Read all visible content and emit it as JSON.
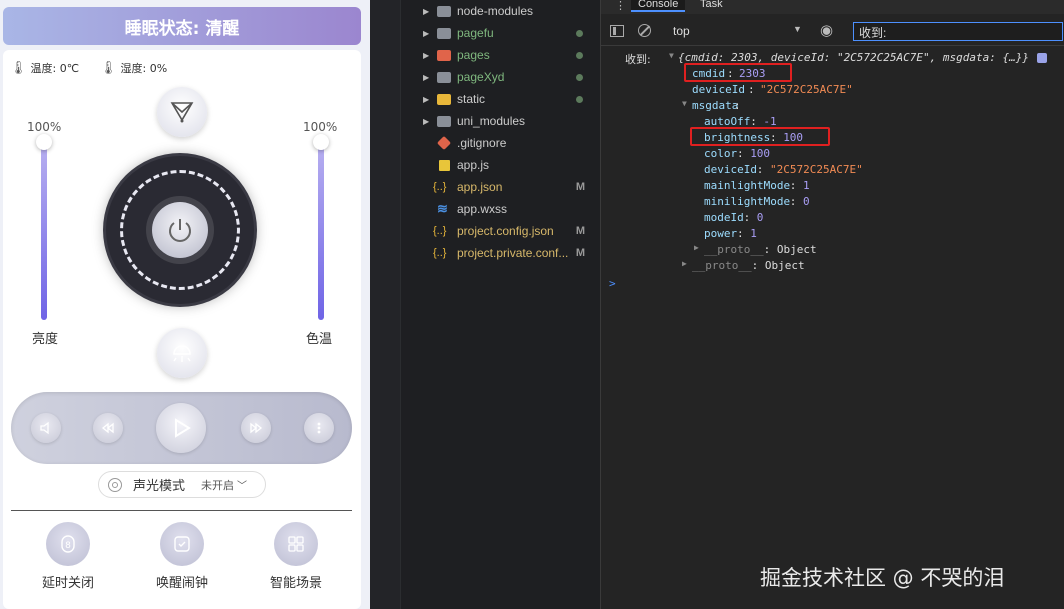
{
  "phone": {
    "title": "睡眠状态: 清醒",
    "temperature": "温度: 0℃",
    "humidity": "湿度: 0%",
    "brightness_pct": "100%",
    "colortemp_pct": "100%",
    "brightness_level": 1.0,
    "colortemp_level": 1.0,
    "brightness_label": "亮度",
    "colortemp_label": "色温",
    "mode_label": "声光模式",
    "mode_value": "未开启",
    "bottom": [
      {
        "label": "延时关闭"
      },
      {
        "label": "唤醒闹钟"
      },
      {
        "label": "智能场景"
      }
    ]
  },
  "explorer": {
    "items": [
      {
        "name": "node-modules",
        "type": "folder",
        "color": "#8a8f98",
        "text_color": "#cccccc",
        "badge": ""
      },
      {
        "name": "pagefu",
        "type": "folder",
        "color": "#8a8f98",
        "text_color": "#7fb77e",
        "badge": "dot"
      },
      {
        "name": "pages",
        "type": "folder",
        "color": "#e0644a",
        "text_color": "#7fb77e",
        "badge": "dot"
      },
      {
        "name": "pageXyd",
        "type": "folder",
        "color": "#8a8f98",
        "text_color": "#7fb77e",
        "badge": "dot"
      },
      {
        "name": "static",
        "type": "folder",
        "color": "#e8b73a",
        "text_color": "#cccccc",
        "badge": "dot"
      },
      {
        "name": "uni_modules",
        "type": "folder",
        "color": "#8a8f98",
        "text_color": "#cccccc",
        "badge": ""
      },
      {
        "name": ".gitignore",
        "type": "git",
        "color": "#e0644a",
        "text_color": "#cccccc",
        "badge": ""
      },
      {
        "name": "app.js",
        "type": "js",
        "color": "#e8c53a",
        "text_color": "#cccccc",
        "badge": ""
      },
      {
        "name": "app.json",
        "type": "json",
        "color": "#e8b73a",
        "text_color": "#d7b86a",
        "badge": "M"
      },
      {
        "name": "app.wxss",
        "type": "css",
        "color": "#4a8fe0",
        "text_color": "#cccccc",
        "badge": ""
      },
      {
        "name": "project.config.json",
        "type": "json",
        "color": "#e8b73a",
        "text_color": "#d7b86a",
        "badge": "M"
      },
      {
        "name": "project.private.conf...",
        "type": "json",
        "color": "#e8b73a",
        "text_color": "#d7b86a",
        "badge": "M"
      }
    ]
  },
  "devtools": {
    "tabs": [
      "Console",
      "Task"
    ],
    "context": "top",
    "filter": "收到:",
    "log_prefix": "收到:",
    "summary": "{cmdid: 2303, deviceId: \"2C572C25AC7E\", msgdata: {…}}",
    "cmdid_key": "cmdid",
    "cmdid_val": "2303",
    "deviceId_key": "deviceId",
    "deviceId_val": "\"2C572C25AC7E\"",
    "msgdata_key": "msgdata",
    "fields": [
      {
        "key": "autoOff",
        "val": "-1"
      },
      {
        "key": "brightness",
        "val": "100"
      },
      {
        "key": "color",
        "val": "100"
      },
      {
        "key": "deviceId",
        "val": "\"2C572C25AC7E\""
      },
      {
        "key": "mainlightMode",
        "val": "1"
      },
      {
        "key": "minilightMode",
        "val": "0"
      },
      {
        "key": "modeId",
        "val": "0"
      },
      {
        "key": "power",
        "val": "1"
      }
    ],
    "proto_inner": "__proto__: Object",
    "proto_outer": "__proto__: Object",
    "prompt": ">"
  },
  "watermark": "掘金技术社区 @ 不哭的泪"
}
